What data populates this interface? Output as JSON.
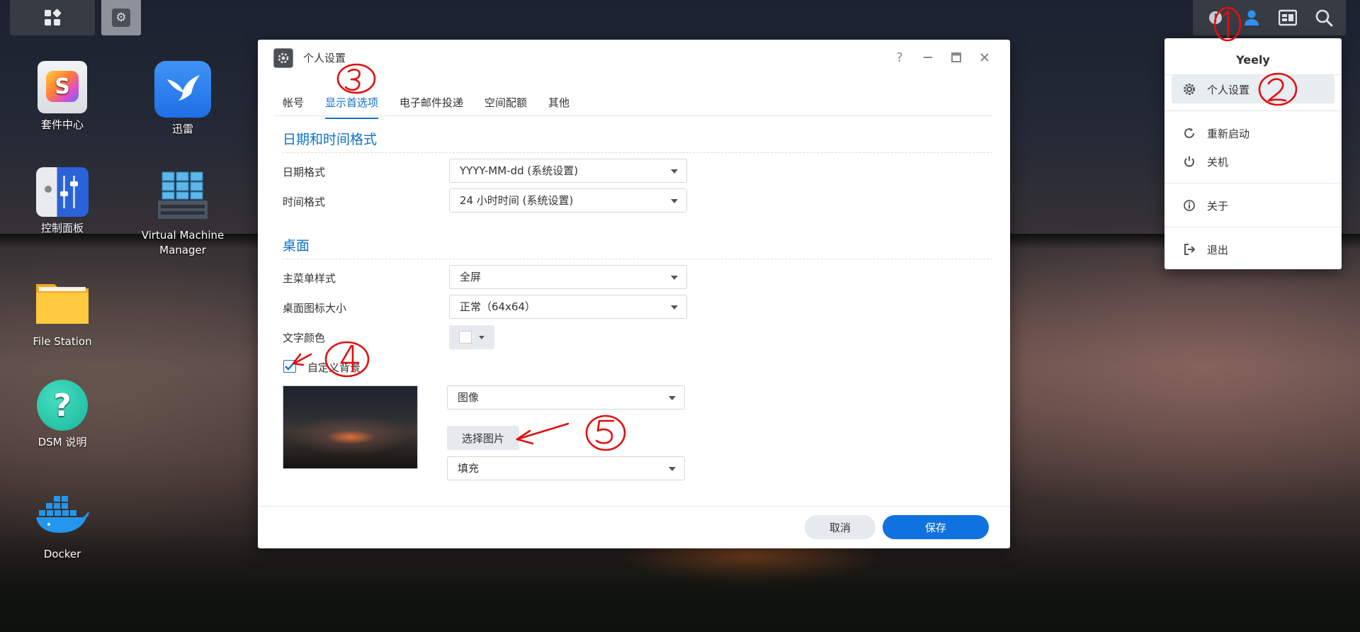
{
  "desktop": {
    "icons": [
      {
        "label": "套件中心"
      },
      {
        "label": "迅雷"
      },
      {
        "label": "控制面板"
      },
      {
        "label": "Virtual Machine Manager"
      },
      {
        "label": "File Station"
      },
      {
        "label": "DSM 说明"
      },
      {
        "label": "Docker"
      }
    ]
  },
  "taskbar": {
    "main_menu_icon": "grid-icon",
    "open_app_icon": "personal-settings-icon",
    "tray_icons": [
      "notification-icon",
      "user-icon",
      "widgets-icon",
      "search-icon"
    ]
  },
  "dialog": {
    "title": "个人设置",
    "help": "?",
    "tabs": [
      {
        "label": "帐号",
        "active": false
      },
      {
        "label": "显示首选项",
        "active": true
      },
      {
        "label": "电子邮件投递",
        "active": false
      },
      {
        "label": "空间配额",
        "active": false
      },
      {
        "label": "其他",
        "active": false
      }
    ],
    "section_datetime": {
      "title": "日期和时间格式",
      "date_label": "日期格式",
      "date_value": "YYYY-MM-dd (系统设置)",
      "time_label": "时间格式",
      "time_value": "24 小时时间 (系统设置)"
    },
    "section_desktop": {
      "title": "桌面",
      "menu_style_label": "主菜单样式",
      "menu_style_value": "全屏",
      "icon_size_label": "桌面图标大小",
      "icon_size_value": "正常（64x64）",
      "text_color_label": "文字颜色",
      "text_color_value": "#ffffff",
      "custom_bg_label": "自定义背景",
      "custom_bg_checked": true,
      "bg_type_value": "图像",
      "select_image_label": "选择图片",
      "fill_value": "填充"
    },
    "footer": {
      "cancel_label": "取消",
      "save_label": "保存"
    }
  },
  "user_menu": {
    "username": "Yeely",
    "items": [
      {
        "label": "个人设置",
        "icon": "gear-icon"
      },
      {
        "label": "重新启动",
        "icon": "restart-icon"
      },
      {
        "label": "关机",
        "icon": "power-icon"
      },
      {
        "label": "关于",
        "icon": "info-icon"
      },
      {
        "label": "退出",
        "icon": "logout-icon"
      }
    ]
  },
  "colors": {
    "accent": "#0f72c9",
    "primary_button": "#0f72e0",
    "annotation": "#e01010"
  }
}
